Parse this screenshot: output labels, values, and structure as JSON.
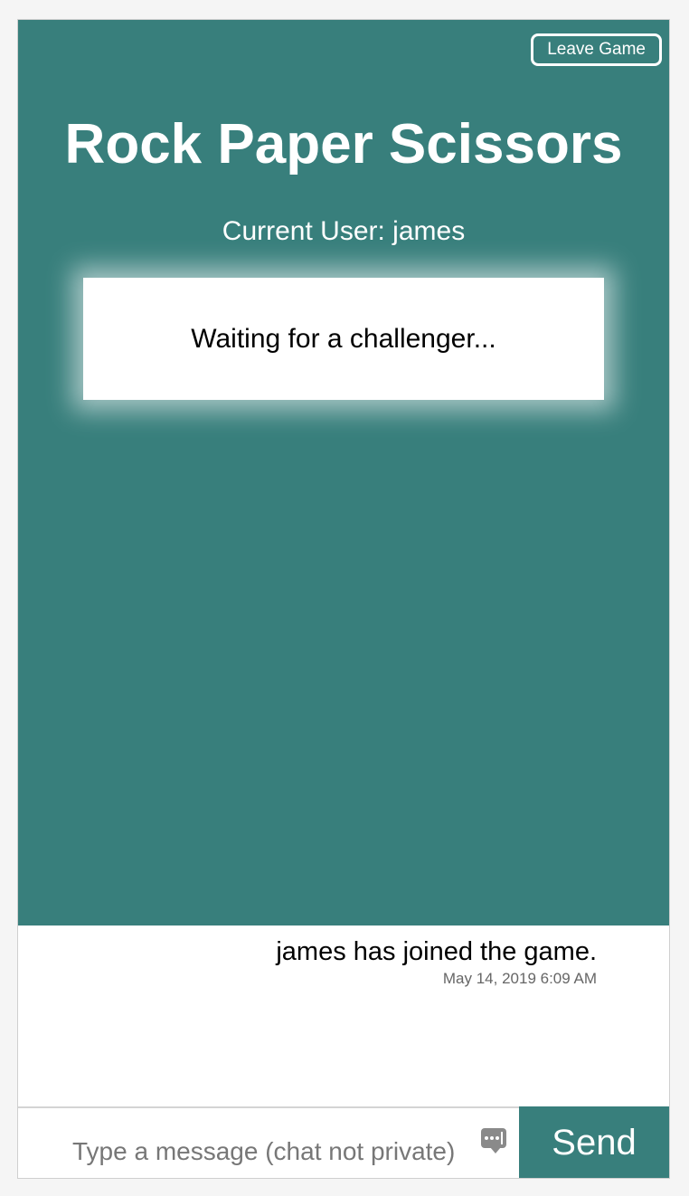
{
  "header": {
    "leave_label": "Leave Game",
    "title": "Rock Paper Scissors",
    "current_user": "Current User: james"
  },
  "status": {
    "message": "Waiting for a challenger..."
  },
  "chat": {
    "messages": [
      {
        "text": "james has joined the game.",
        "timestamp": "May 14, 2019 6:09 AM"
      }
    ]
  },
  "composer": {
    "value": "",
    "placeholder": "Type a message (chat not private)",
    "send_label": "Send"
  },
  "colors": {
    "accent": "#387f7c",
    "surface": "#ffffff",
    "muted_text": "#666666"
  },
  "icons": {
    "input_icon": "password-dots-icon"
  }
}
